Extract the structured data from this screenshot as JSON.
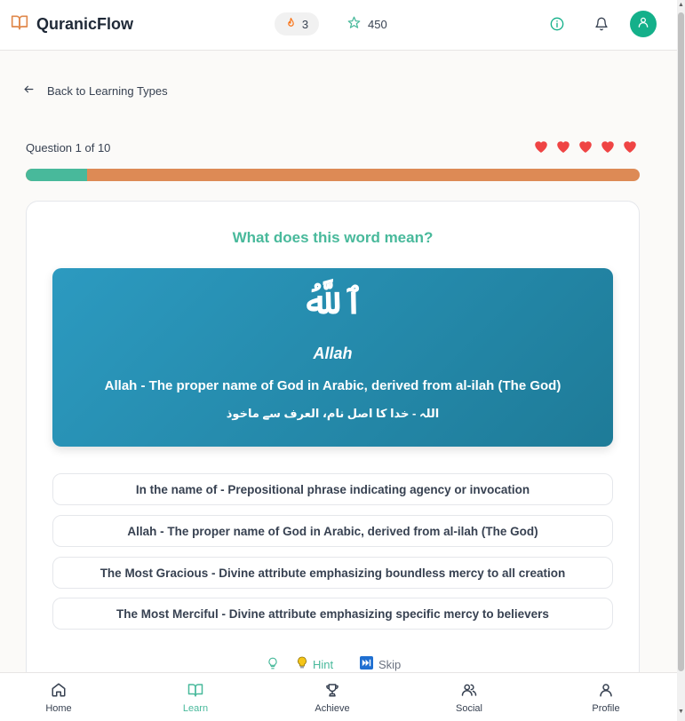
{
  "header": {
    "app_title": "QuranicFlow",
    "streak_count": "3",
    "xp_count": "450"
  },
  "back_label": "Back to Learning Types",
  "quiz": {
    "question_counter": "Question 1 of 10",
    "lives": 5,
    "progress_fraction": 0.1,
    "prompt": "What does this word mean?",
    "word": {
      "arabic": "ٱللَّهُ",
      "transliteration": "Allah",
      "meaning": "Allah - The proper name of God in Arabic, derived from al-ilah (The God)",
      "urdu": "اللہ - خدا کا اصل نام، العرف سے ماخوذ"
    },
    "options": [
      "In the name of - Prepositional phrase indicating agency or invocation",
      "Allah - The proper name of God in Arabic, derived from al-ilah (The God)",
      "The Most Gracious - Divine attribute emphasizing boundless mercy to all creation",
      "The Most Merciful - Divine attribute emphasizing specific mercy to believers"
    ],
    "hint_label": "Hint",
    "skip_label": "Skip"
  },
  "nav": {
    "home": "Home",
    "learn": "Learn",
    "achieve": "Achieve",
    "social": "Social",
    "profile": "Profile",
    "active": "learn"
  },
  "colors": {
    "accent": "#48b99b",
    "progress_remaining": "#dd8a55",
    "heart": "#ef4444",
    "panel": "#2c9ac0"
  }
}
